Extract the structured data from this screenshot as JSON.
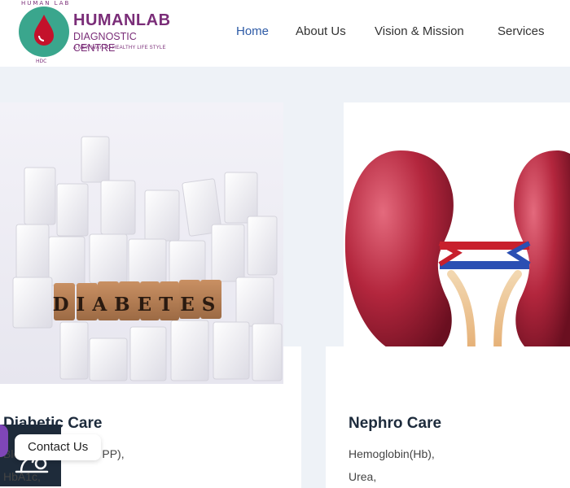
{
  "brand": {
    "arc_text": "HUMAN LAB",
    "name": "HUMANLAB",
    "subtitle": "DIAGNOSTIC CENTRE",
    "tagline": "A NEW WAY TO HEALTHY LIFE STYLE",
    "mark": "HDC",
    "colors": {
      "primary": "#7a2d78",
      "circle": "#3aa68d",
      "drop": "#c4112b"
    }
  },
  "nav": {
    "items": [
      {
        "label": "Home",
        "active": true
      },
      {
        "label": "About Us",
        "active": false
      },
      {
        "label": "Vision & Mission",
        "active": false
      },
      {
        "label": "Services",
        "active": false
      }
    ]
  },
  "cards": [
    {
      "image_text": "DIABETES",
      "icon": "microscope-icon",
      "title": "Diabetic Care",
      "lines": [
        "Blood Glucose(FS, PP),",
        "HbA1c,"
      ]
    },
    {
      "icon": "kidney-image",
      "title": "Nephro Care",
      "lines": [
        "Hemoglobin(Hb),",
        "Urea,"
      ]
    }
  ],
  "contact": {
    "label": "Contact Us"
  }
}
